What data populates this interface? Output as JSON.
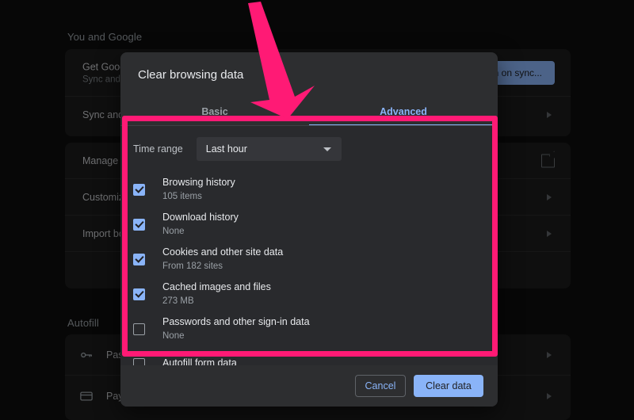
{
  "background": {
    "sections": [
      {
        "title": "You and Google"
      },
      {
        "title": "Autofill"
      }
    ],
    "rows": [
      {
        "title": "Get Google smarts in Chrome",
        "sub": "Sync and personalize Chrome across your devices",
        "action_label": "Turn on sync...",
        "icon": "none"
      },
      {
        "title": "Sync and Google services",
        "sub": "",
        "icon": "chevron-right-icon"
      },
      {
        "title": "Manage your Google Account",
        "sub": "",
        "icon": "external-link-icon"
      },
      {
        "title": "Customize your Chrome profile",
        "sub": "",
        "icon": "chevron-right-icon"
      },
      {
        "title": "Import bookmarks and settings",
        "sub": "",
        "icon": "chevron-right-icon"
      },
      {
        "title": "Passwords",
        "sub": "",
        "icon": "chevron-right-icon",
        "leading_icon": "key-icon"
      },
      {
        "title": "Payment methods",
        "sub": "",
        "icon": "chevron-right-icon",
        "leading_icon": "credit-card-icon"
      }
    ]
  },
  "dialog": {
    "title": "Clear browsing data",
    "tabs": [
      {
        "label": "Basic",
        "active": false
      },
      {
        "label": "Advanced",
        "active": true
      }
    ],
    "time_range": {
      "label": "Time range",
      "value": "Last hour",
      "caret_icon": "chevron-down-icon"
    },
    "items": [
      {
        "title": "Browsing history",
        "sub": "105 items",
        "checked": true
      },
      {
        "title": "Download history",
        "sub": "None",
        "checked": true
      },
      {
        "title": "Cookies and other site data",
        "sub": "From 182 sites",
        "checked": true
      },
      {
        "title": "Cached images and files",
        "sub": "273 MB",
        "checked": true
      },
      {
        "title": "Passwords and other sign-in data",
        "sub": "None",
        "checked": false
      },
      {
        "title": "Autofill form data",
        "sub": "",
        "checked": false
      }
    ],
    "footer": {
      "cancel_label": "Cancel",
      "confirm_label": "Clear data"
    }
  },
  "annotations": {
    "highlight_color": "#ff1a75",
    "arrow_color": "#ff1a75"
  },
  "colors": {
    "accent_blue": "#8ab4f8",
    "dialog_bg": "#2d2e30",
    "body_bg": "#292a2d",
    "page_bg": "#0d0d0d"
  }
}
